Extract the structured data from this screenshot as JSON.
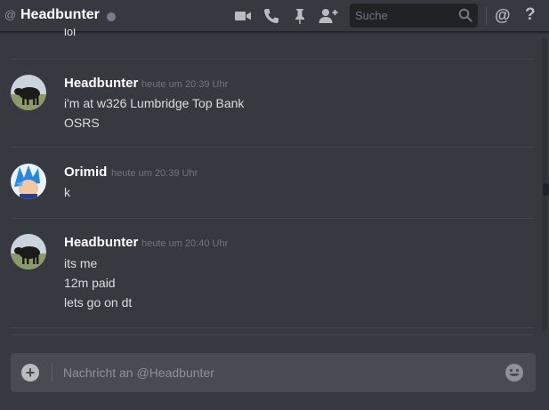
{
  "header": {
    "at_symbol": "@",
    "channel_name": "Headbunter",
    "status": "offline",
    "search_placeholder": "Suche",
    "icons": [
      "video-call-icon",
      "phone-call-icon",
      "pin-icon",
      "add-friend-icon",
      "search-icon",
      "mention-icon",
      "help-icon"
    ],
    "mention_glyph": "@",
    "help_glyph": "?"
  },
  "messages": {
    "partial_previous_line": "lol",
    "groups": [
      {
        "author": "Headbunter",
        "timestamp": "heute um 20:39 Uhr",
        "lines": [
          "i'm at w326 Lumbridge Top Bank",
          "OSRS"
        ]
      },
      {
        "author": "Orimid",
        "timestamp": "heute um 20:39 Uhr",
        "lines": [
          "k"
        ]
      },
      {
        "author": "Headbunter",
        "timestamp": "heute um 20:40 Uhr",
        "lines": [
          "its me",
          "12m paid",
          "lets go on dt"
        ]
      }
    ]
  },
  "composer": {
    "placeholder": "Nachricht an @Headbunter",
    "add_glyph": "+"
  },
  "colors": {
    "background": "#36393f",
    "composer_bg": "#484c52",
    "author": "#ffffff",
    "text": "#dcddde",
    "timestamp": "#72767d"
  }
}
